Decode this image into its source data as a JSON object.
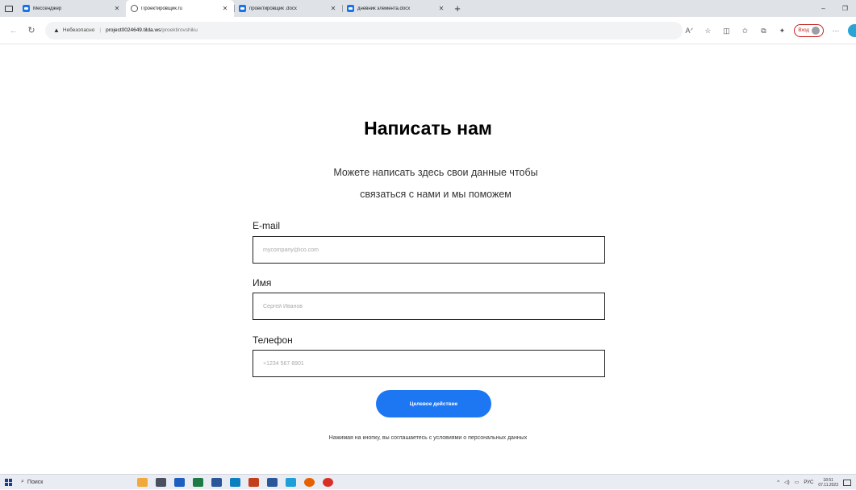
{
  "browser": {
    "tabs": [
      {
        "title": "Мессенджер",
        "active": false
      },
      {
        "title": "Проектировщик.ru",
        "active": true
      },
      {
        "title": "проектировщик .docx",
        "active": false
      },
      {
        "title": "дневник элемента.docx",
        "active": false
      }
    ],
    "new_tab_symbol": "+",
    "window_controls": {
      "minimize": "–",
      "restore": "❐"
    },
    "address": {
      "security_label": "Небезопасно",
      "host": "project0024649.tilda.ws",
      "path": "/proektirovshiku"
    },
    "profile_button": "Вход"
  },
  "form": {
    "title": "Написать нам",
    "subtitle": "Можете написать здесь свои данные чтобы связаться с нами и мы поможем",
    "email_label": "E-mail",
    "email_placeholder": "mycompany@ico.com",
    "name_label": "Имя",
    "name_placeholder": "Сергей Иванов",
    "phone_label": "Телефон",
    "phone_placeholder": "+1234 567 8901",
    "submit_label": "Целевое действие",
    "consent_text": "Нажимая на кнопку, вы соглашаетесь с условиями о персональных данных"
  },
  "taskbar": {
    "search_label": "Поиск",
    "language": "РУС",
    "time": "18:51",
    "date": "07.11.2023"
  },
  "colors": {
    "accent": "#1d77f3",
    "warning": "#c5221f"
  }
}
